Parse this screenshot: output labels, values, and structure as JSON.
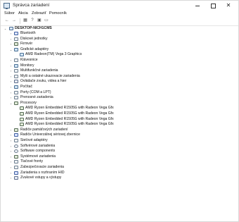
{
  "window": {
    "title": "Správca zariadení",
    "controls": {
      "minimize": "",
      "maximize": "",
      "close": "✕"
    }
  },
  "menu": [
    "Súbor",
    "Akcia",
    "Zobraziť",
    "Pomocník"
  ],
  "toolbar": {
    "buttons": [
      {
        "name": "back-icon",
        "glyph": "←"
      },
      {
        "name": "forward-icon",
        "glyph": "→"
      },
      {
        "name": "properties-icon",
        "glyph": "▦"
      },
      {
        "name": "help-icon",
        "glyph": "?"
      },
      {
        "name": "driver-icon",
        "glyph": "▣"
      },
      {
        "name": "monitor-icon",
        "glyph": "▭"
      }
    ]
  },
  "tree": {
    "root": {
      "label": "DESKTOP-NICH1CMS",
      "icon": "computer-icon",
      "expanded": true
    },
    "nodes": [
      {
        "label": "Bluetooth",
        "icon": "bluetooth-icon",
        "expanded": false,
        "children": []
      },
      {
        "label": "Diskové jednotky",
        "icon": "disk-icon",
        "expanded": false,
        "children": []
      },
      {
        "label": "Firmvér",
        "icon": "firmware-icon",
        "expanded": false,
        "children": []
      },
      {
        "label": "Grafické adaptéry",
        "icon": "display-adapter-icon",
        "expanded": true,
        "children": [
          "AMD Radeon(TM) Vega 3 Graphics"
        ]
      },
      {
        "label": "Klávesnice",
        "icon": "keyboard-icon",
        "expanded": false,
        "children": []
      },
      {
        "label": "Monitory",
        "icon": "monitor-icon",
        "expanded": false,
        "children": []
      },
      {
        "label": "Multifunkčné zariadenia",
        "icon": "multifunction-icon",
        "expanded": false,
        "children": []
      },
      {
        "label": "Myši a ostatné ukazovacie zariadenia",
        "icon": "mouse-icon",
        "expanded": false,
        "children": []
      },
      {
        "label": "Ovládače zvuku, videa a hier",
        "icon": "audio-icon",
        "expanded": false,
        "children": []
      },
      {
        "label": "Počítač",
        "icon": "computer-icon",
        "expanded": false,
        "children": []
      },
      {
        "label": "Porty (COM a LPT)",
        "icon": "port-icon",
        "expanded": false,
        "children": []
      },
      {
        "label": "Prenosné zariadenia",
        "icon": "portable-device-icon",
        "expanded": false,
        "children": []
      },
      {
        "label": "Procesory",
        "icon": "processor-icon",
        "expanded": true,
        "children": [
          "AMD Ryzen Embedded R1505G with Radeon Vega Gfx",
          "AMD Ryzen Embedded R1505G with Radeon Vega Gfx",
          "AMD Ryzen Embedded R1505G with Radeon Vega Gfx",
          "AMD Ryzen Embedded R1505G with Radeon Vega Gfx"
        ]
      },
      {
        "label": "Radiče pamäťových zariadení",
        "icon": "storage-controller-icon",
        "expanded": false,
        "children": []
      },
      {
        "label": "Radiče Univerzálnej sériovej zbernice",
        "icon": "usb-icon",
        "expanded": false,
        "children": []
      },
      {
        "label": "Sieťové adaptéry",
        "icon": "network-icon",
        "expanded": false,
        "children": []
      },
      {
        "label": "Softvérové zariadenia",
        "icon": "software-device-icon",
        "expanded": false,
        "children": []
      },
      {
        "label": "Software components",
        "icon": "software-component-icon",
        "expanded": false,
        "children": []
      },
      {
        "label": "Systémové zariadenia",
        "icon": "system-device-icon",
        "expanded": false,
        "children": []
      },
      {
        "label": "Tlačové fronty",
        "icon": "printer-icon",
        "expanded": false,
        "children": []
      },
      {
        "label": "Zabezpečovacie zariadenia",
        "icon": "security-device-icon",
        "expanded": false,
        "children": []
      },
      {
        "label": "Zariadenia s rozhraním HID",
        "icon": "hid-icon",
        "expanded": false,
        "children": []
      },
      {
        "label": "Zvukové vstupy a výstupy",
        "icon": "speaker-icon",
        "expanded": false,
        "children": []
      }
    ]
  },
  "glyphs": {
    "expanded": "⌄",
    "collapsed": "›"
  },
  "colors": {
    "selected_background": "#cce8ff",
    "border": "#d9d9d9"
  }
}
